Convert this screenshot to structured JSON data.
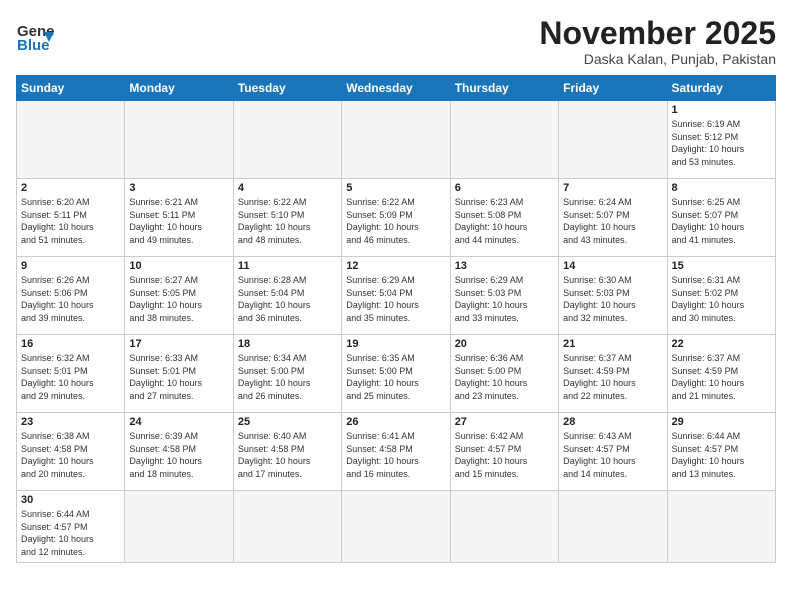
{
  "header": {
    "logo": {
      "part1": "General",
      "part2": "Blue"
    },
    "title": "November 2025",
    "location": "Daska Kalan, Punjab, Pakistan"
  },
  "calendar": {
    "days_of_week": [
      "Sunday",
      "Monday",
      "Tuesday",
      "Wednesday",
      "Thursday",
      "Friday",
      "Saturday"
    ],
    "weeks": [
      [
        {
          "day": "",
          "info": ""
        },
        {
          "day": "",
          "info": ""
        },
        {
          "day": "",
          "info": ""
        },
        {
          "day": "",
          "info": ""
        },
        {
          "day": "",
          "info": ""
        },
        {
          "day": "",
          "info": ""
        },
        {
          "day": "1",
          "info": "Sunrise: 6:19 AM\nSunset: 5:12 PM\nDaylight: 10 hours\nand 53 minutes."
        }
      ],
      [
        {
          "day": "2",
          "info": "Sunrise: 6:20 AM\nSunset: 5:11 PM\nDaylight: 10 hours\nand 51 minutes."
        },
        {
          "day": "3",
          "info": "Sunrise: 6:21 AM\nSunset: 5:11 PM\nDaylight: 10 hours\nand 49 minutes."
        },
        {
          "day": "4",
          "info": "Sunrise: 6:22 AM\nSunset: 5:10 PM\nDaylight: 10 hours\nand 48 minutes."
        },
        {
          "day": "5",
          "info": "Sunrise: 6:22 AM\nSunset: 5:09 PM\nDaylight: 10 hours\nand 46 minutes."
        },
        {
          "day": "6",
          "info": "Sunrise: 6:23 AM\nSunset: 5:08 PM\nDaylight: 10 hours\nand 44 minutes."
        },
        {
          "day": "7",
          "info": "Sunrise: 6:24 AM\nSunset: 5:07 PM\nDaylight: 10 hours\nand 43 minutes."
        },
        {
          "day": "8",
          "info": "Sunrise: 6:25 AM\nSunset: 5:07 PM\nDaylight: 10 hours\nand 41 minutes."
        }
      ],
      [
        {
          "day": "9",
          "info": "Sunrise: 6:26 AM\nSunset: 5:06 PM\nDaylight: 10 hours\nand 39 minutes."
        },
        {
          "day": "10",
          "info": "Sunrise: 6:27 AM\nSunset: 5:05 PM\nDaylight: 10 hours\nand 38 minutes."
        },
        {
          "day": "11",
          "info": "Sunrise: 6:28 AM\nSunset: 5:04 PM\nDaylight: 10 hours\nand 36 minutes."
        },
        {
          "day": "12",
          "info": "Sunrise: 6:29 AM\nSunset: 5:04 PM\nDaylight: 10 hours\nand 35 minutes."
        },
        {
          "day": "13",
          "info": "Sunrise: 6:29 AM\nSunset: 5:03 PM\nDaylight: 10 hours\nand 33 minutes."
        },
        {
          "day": "14",
          "info": "Sunrise: 6:30 AM\nSunset: 5:03 PM\nDaylight: 10 hours\nand 32 minutes."
        },
        {
          "day": "15",
          "info": "Sunrise: 6:31 AM\nSunset: 5:02 PM\nDaylight: 10 hours\nand 30 minutes."
        }
      ],
      [
        {
          "day": "16",
          "info": "Sunrise: 6:32 AM\nSunset: 5:01 PM\nDaylight: 10 hours\nand 29 minutes."
        },
        {
          "day": "17",
          "info": "Sunrise: 6:33 AM\nSunset: 5:01 PM\nDaylight: 10 hours\nand 27 minutes."
        },
        {
          "day": "18",
          "info": "Sunrise: 6:34 AM\nSunset: 5:00 PM\nDaylight: 10 hours\nand 26 minutes."
        },
        {
          "day": "19",
          "info": "Sunrise: 6:35 AM\nSunset: 5:00 PM\nDaylight: 10 hours\nand 25 minutes."
        },
        {
          "day": "20",
          "info": "Sunrise: 6:36 AM\nSunset: 5:00 PM\nDaylight: 10 hours\nand 23 minutes."
        },
        {
          "day": "21",
          "info": "Sunrise: 6:37 AM\nSunset: 4:59 PM\nDaylight: 10 hours\nand 22 minutes."
        },
        {
          "day": "22",
          "info": "Sunrise: 6:37 AM\nSunset: 4:59 PM\nDaylight: 10 hours\nand 21 minutes."
        }
      ],
      [
        {
          "day": "23",
          "info": "Sunrise: 6:38 AM\nSunset: 4:58 PM\nDaylight: 10 hours\nand 20 minutes."
        },
        {
          "day": "24",
          "info": "Sunrise: 6:39 AM\nSunset: 4:58 PM\nDaylight: 10 hours\nand 18 minutes."
        },
        {
          "day": "25",
          "info": "Sunrise: 6:40 AM\nSunset: 4:58 PM\nDaylight: 10 hours\nand 17 minutes."
        },
        {
          "day": "26",
          "info": "Sunrise: 6:41 AM\nSunset: 4:58 PM\nDaylight: 10 hours\nand 16 minutes."
        },
        {
          "day": "27",
          "info": "Sunrise: 6:42 AM\nSunset: 4:57 PM\nDaylight: 10 hours\nand 15 minutes."
        },
        {
          "day": "28",
          "info": "Sunrise: 6:43 AM\nSunset: 4:57 PM\nDaylight: 10 hours\nand 14 minutes."
        },
        {
          "day": "29",
          "info": "Sunrise: 6:44 AM\nSunset: 4:57 PM\nDaylight: 10 hours\nand 13 minutes."
        }
      ],
      [
        {
          "day": "30",
          "info": "Sunrise: 6:44 AM\nSunset: 4:57 PM\nDaylight: 10 hours\nand 12 minutes."
        },
        {
          "day": "",
          "info": ""
        },
        {
          "day": "",
          "info": ""
        },
        {
          "day": "",
          "info": ""
        },
        {
          "day": "",
          "info": ""
        },
        {
          "day": "",
          "info": ""
        },
        {
          "day": "",
          "info": ""
        }
      ]
    ]
  }
}
